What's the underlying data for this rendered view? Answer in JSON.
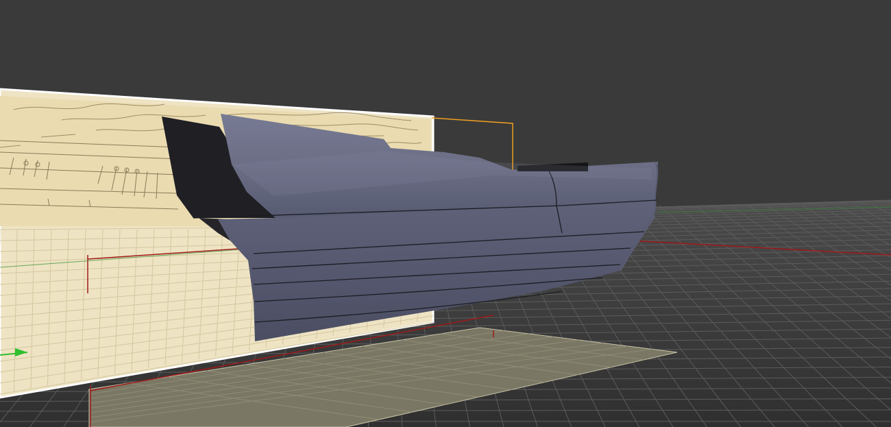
{
  "viewport": {
    "label": "",
    "background_color": "#3a3a3a"
  },
  "scene": {
    "grid_color": "#5a5a5a",
    "blueprint_paper_color": "#efe3c0",
    "blueprint_ink_color": "#8a7a5a",
    "hull_color": "#6c6f86",
    "hull_shadow_color": "#222228",
    "selection_color": "#f0a020",
    "axis_x_color": "#a01818",
    "axis_y_color": "#20a020",
    "ground_plane_color": "#7d7966"
  }
}
